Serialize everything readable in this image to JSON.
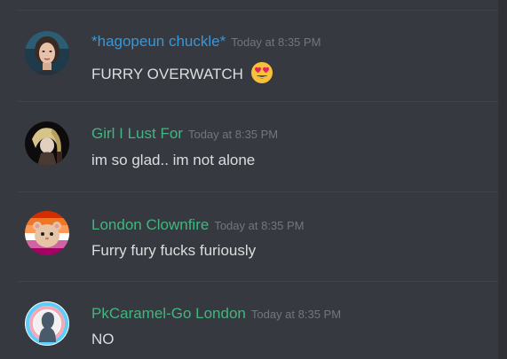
{
  "colors": {
    "background": "#36393f",
    "divider": "#40434a",
    "username_blue": "#3498db",
    "username_green": "#43b581",
    "text": "#dcddde",
    "timestamp": "#72767d"
  },
  "messages": [
    {
      "author": "*hagopeun chuckle*",
      "author_color": "#3498db",
      "timestamp": "Today at 8:35 PM",
      "text": "FURRY OVERWATCH",
      "emoji": "heart-eyes-emoji",
      "avatar_icon": "woman-portrait-avatar"
    },
    {
      "author": "Girl I Lust For",
      "author_color": "#43b581",
      "timestamp": "Today at 8:35 PM",
      "text": "im so glad.. im not alone",
      "avatar_icon": "blonde-character-avatar"
    },
    {
      "author": "London Clownfire",
      "author_color": "#43b581",
      "timestamp": "Today at 8:35 PM",
      "text": "Furry fury fucks furiously",
      "avatar_icon": "hamster-pride-flag-avatar"
    },
    {
      "author": "PkCaramel-Go London",
      "author_color": "#43b581",
      "timestamp": "Today at 8:35 PM",
      "text": "NO",
      "avatar_icon": "silhouette-trans-flag-avatar"
    }
  ]
}
